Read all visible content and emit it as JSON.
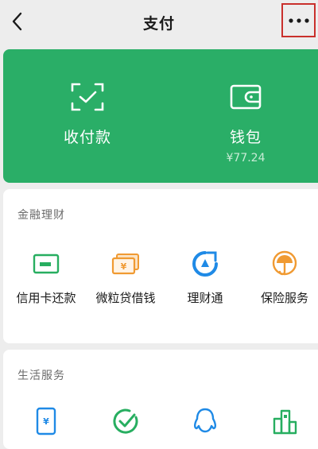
{
  "header": {
    "title": "支付"
  },
  "wallet_panel": {
    "receive_pay": {
      "label": "收付款",
      "icon": "scan-frame-icon"
    },
    "wallet": {
      "label": "钱包",
      "amount": "¥77.24",
      "icon": "wallet-icon"
    }
  },
  "finance": {
    "title": "金融理财",
    "items": [
      {
        "label": "信用卡还款",
        "icon": "credit-card-icon"
      },
      {
        "label": "微粒贷借钱",
        "icon": "yuan-cards-icon"
      },
      {
        "label": "理财通",
        "icon": "licaitong-icon"
      },
      {
        "label": "保险服务",
        "icon": "umbrella-icon"
      }
    ]
  },
  "life": {
    "title": "生活服务",
    "items": [
      {
        "label": "",
        "icon": "phone-yuan-icon"
      },
      {
        "label": "",
        "icon": "check-circle-icon"
      },
      {
        "label": "",
        "icon": "qq-penguin-icon"
      },
      {
        "label": "",
        "icon": "city-buildings-icon"
      }
    ]
  },
  "colors": {
    "accent_green": "#2aae67",
    "icon_blue": "#1f8ae6",
    "icon_orange": "#f09a32",
    "icon_green": "#27ae60",
    "highlight_red": "#c9302c",
    "page_bg": "#ededed"
  }
}
